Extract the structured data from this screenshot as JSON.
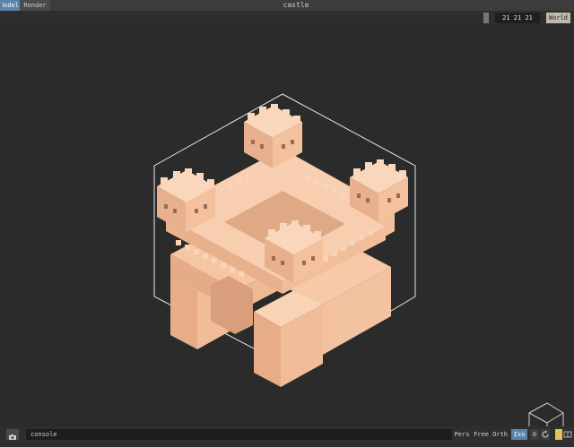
{
  "tabs": {
    "model": "Model",
    "render": "Render"
  },
  "title": "castle",
  "toolbar": {
    "dimensions": "21 21 21",
    "world_label": "World"
  },
  "console": {
    "placeholder": "console"
  },
  "camera_modes": {
    "pers": "Pers",
    "free": "Free",
    "orth": "Orth",
    "iso": "Iso"
  },
  "status": {
    "zero": "0"
  },
  "colors": {
    "voxel": "#f6c4a2",
    "accent": "#5b84a8",
    "palette_swatch": "#e3c15a"
  }
}
